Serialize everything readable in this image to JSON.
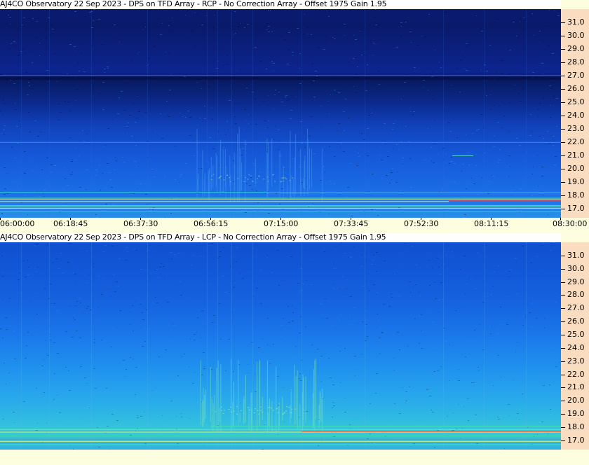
{
  "chart_data": [
    {
      "type": "heatmap",
      "title": "AJ4CO Observatory 22 Sep 2023 - DPS on TFD Array  - RCP  -  No Correction Array  -  Offset 1975  Gain 1.95",
      "polarization": "RCP",
      "y_ticks": [
        "31.0",
        "30.0",
        "29.0",
        "28.0",
        "27.0",
        "26.0",
        "25.0",
        "24.0",
        "23.0",
        "22.0",
        "21.0",
        "20.0",
        "19.0",
        "18.0",
        "17.0"
      ],
      "ylim": [
        16.3,
        32.0
      ],
      "x_ticks": [
        "06:00:00",
        "06:18:45",
        "06:37:30",
        "06:56:15",
        "07:15:00",
        "07:33:45",
        "07:52:30",
        "08:11:15",
        "08:30:00"
      ],
      "xlim": [
        "06:00:00",
        "08:30:00"
      ],
      "colorscale": [
        "#000a4a",
        "#0a2a9a",
        "#1550d8",
        "#1f80f0",
        "#2aa8f0",
        "#40d0d0",
        "#f0f040",
        "#ff4040"
      ]
    },
    {
      "type": "heatmap",
      "title": "AJ4CO Observatory 22 Sep 2023 - DPS on TFD Array  - LCP  -  No Correction Array  -  Offset 1975  Gain 1.95",
      "polarization": "LCP",
      "y_ticks": [
        "31.0",
        "30.0",
        "29.0",
        "28.0",
        "27.0",
        "26.0",
        "25.0",
        "24.0",
        "23.0",
        "22.0",
        "21.0",
        "20.0",
        "19.0",
        "18.0",
        "17.0"
      ],
      "ylim": [
        16.3,
        32.0
      ],
      "x_ticks": [],
      "colorscale": [
        "#0a2a9a",
        "#1550d8",
        "#1f80f0",
        "#2aa8f0",
        "#40d0d0",
        "#f0f040",
        "#ff4040"
      ]
    }
  ]
}
